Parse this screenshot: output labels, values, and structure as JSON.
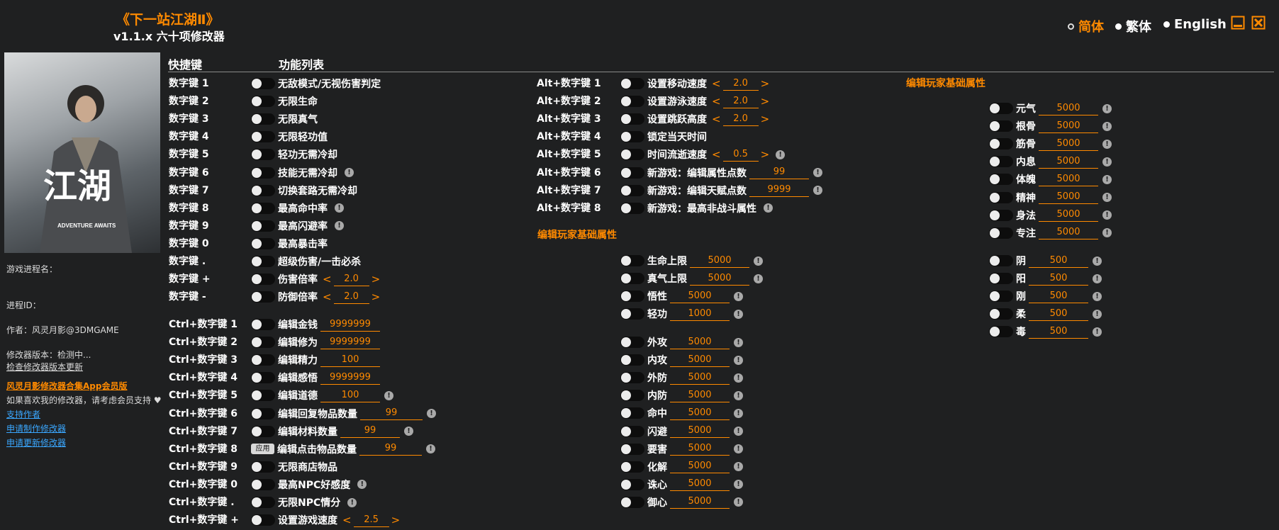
{
  "app": {
    "title": "《下一站江湖Ⅱ》",
    "subtitle": "v1.1.x 六十项修改器",
    "accent_color": "#ff8a00",
    "bg_color": "#1f2021"
  },
  "languages": [
    {
      "label": "简体",
      "selected": true
    },
    {
      "label": "繁体",
      "selected": false
    },
    {
      "label": "English",
      "selected": false
    }
  ],
  "window_controls": {
    "minimize_icon": "minimize-icon",
    "close_icon": "close-icon"
  },
  "cover": {
    "title_text": "江湖",
    "subtitle_text": "ADVENTURE AWAITS"
  },
  "sidebar": {
    "process_name_label": "游戏进程名：",
    "process_id_label": "进程ID：",
    "author": "作者：风灵月影@3DMGAME",
    "version": "修改器版本：检测中...",
    "check_update": "检查修改器版本更新",
    "app_promo": "风灵月影修改器合集App会员版",
    "support_text": "如果喜欢我的修改器，请考虑会员支持",
    "links": [
      "支持作者",
      "申请制作修改器",
      "申请更新修改器"
    ]
  },
  "headers": {
    "hotkey": "快捷键",
    "features": "功能列表"
  },
  "col1": [
    {
      "key": "数字键 1",
      "label": "无敌模式/无视伤害判定"
    },
    {
      "key": "数字键 2",
      "label": "无限生命"
    },
    {
      "key": "数字键 3",
      "label": "无限真气"
    },
    {
      "key": "数字键 4",
      "label": "无限轻功值"
    },
    {
      "key": "数字键 5",
      "label": "轻功无需冷却"
    },
    {
      "key": "数字键 6",
      "label": "技能无需冷却",
      "info": true
    },
    {
      "key": "数字键 7",
      "label": "切换套路无需冷却"
    },
    {
      "key": "数字键 8",
      "label": "最高命中率",
      "info": true
    },
    {
      "key": "数字键 9",
      "label": "最高闪避率",
      "info": true
    },
    {
      "key": "数字键 0",
      "label": "最高暴击率"
    },
    {
      "key": "数字键 .",
      "label": "超级伤害/一击必杀"
    },
    {
      "key": "数字键 +",
      "label": "伤害倍率",
      "value": "2.0",
      "arrows": true
    },
    {
      "key": "数字键 -",
      "label": "防御倍率",
      "value": "2.0",
      "arrows": true
    }
  ],
  "col1b": [
    {
      "key": "Ctrl+数字键 1",
      "label": "编辑金钱",
      "value": "9999999"
    },
    {
      "key": "Ctrl+数字键 2",
      "label": "编辑修为",
      "value": "9999999"
    },
    {
      "key": "Ctrl+数字键 3",
      "label": "编辑精力",
      "value": "100"
    },
    {
      "key": "Ctrl+数字键 4",
      "label": "编辑感悟",
      "value": "9999999"
    },
    {
      "key": "Ctrl+数字键 5",
      "label": "编辑道德",
      "value": "100",
      "info": true
    },
    {
      "key": "Ctrl+数字键 6",
      "label": "编辑回复物品数量",
      "value": "99",
      "info": true
    },
    {
      "key": "Ctrl+数字键 7",
      "label": "编辑材料数量",
      "value": "99",
      "info": true
    },
    {
      "key": "Ctrl+数字键 8",
      "label": "编辑点击物品数量",
      "value": "99",
      "info": true,
      "apply": "应用"
    },
    {
      "key": "Ctrl+数字键 9",
      "label": "无限商店物品"
    },
    {
      "key": "Ctrl+数字键 0",
      "label": "最高NPC好感度",
      "info": true
    },
    {
      "key": "Ctrl+数字键 .",
      "label": "无限NPC情分",
      "info": true
    },
    {
      "key": "Ctrl+数字键 +",
      "label": "设置游戏速度",
      "value": "2.5",
      "arrows": true
    }
  ],
  "col2": [
    {
      "key": "Alt+数字键 1",
      "label": "设置移动速度",
      "value": "2.0",
      "arrows": true
    },
    {
      "key": "Alt+数字键 2",
      "label": "设置游泳速度",
      "value": "2.0",
      "arrows": true
    },
    {
      "key": "Alt+数字键 3",
      "label": "设置跳跃高度",
      "value": "2.0",
      "arrows": true
    },
    {
      "key": "Alt+数字键 4",
      "label": "锁定当天时间"
    },
    {
      "key": "Alt+数字键 5",
      "label": "时间流逝速度",
      "value": "0.5",
      "arrows": true,
      "info": true
    },
    {
      "key": "Alt+数字键 6",
      "label": "新游戏：编辑属性点数",
      "value": "99",
      "info": true
    },
    {
      "key": "Alt+数字键 7",
      "label": "新游戏：编辑天赋点数",
      "value": "9999",
      "info": true
    },
    {
      "key": "Alt+数字键 8",
      "label": "新游戏：最高非战斗属性",
      "info": true
    }
  ],
  "section_player": "编辑玩家基础属性",
  "col2b": [
    {
      "label": "生命上限",
      "value": "5000",
      "info": true
    },
    {
      "label": "真气上限",
      "value": "5000",
      "info": true
    },
    {
      "label": "悟性",
      "value": "5000",
      "info": true
    },
    {
      "label": "轻功",
      "value": "1000",
      "info": true
    }
  ],
  "col2c": [
    {
      "label": "外攻",
      "value": "5000"
    },
    {
      "label": "内攻",
      "value": "5000"
    },
    {
      "label": "外防",
      "value": "5000"
    },
    {
      "label": "内防",
      "value": "5000"
    },
    {
      "label": "命中",
      "value": "5000"
    },
    {
      "label": "闪避",
      "value": "5000"
    },
    {
      "label": "要害",
      "value": "5000"
    },
    {
      "label": "化解",
      "value": "5000"
    },
    {
      "label": "诛心",
      "value": "5000"
    },
    {
      "label": "御心",
      "value": "5000"
    }
  ],
  "col3": [
    {
      "label": "元气",
      "value": "5000"
    },
    {
      "label": "根骨",
      "value": "5000"
    },
    {
      "label": "筋骨",
      "value": "5000"
    },
    {
      "label": "内息",
      "value": "5000"
    },
    {
      "label": "体魄",
      "value": "5000"
    },
    {
      "label": "精神",
      "value": "5000"
    },
    {
      "label": "身法",
      "value": "5000"
    },
    {
      "label": "专注",
      "value": "5000"
    }
  ],
  "col3b": [
    {
      "label": "阴",
      "value": "500"
    },
    {
      "label": "阳",
      "value": "500"
    },
    {
      "label": "刚",
      "value": "500"
    },
    {
      "label": "柔",
      "value": "500"
    },
    {
      "label": "毒",
      "value": "500"
    }
  ]
}
